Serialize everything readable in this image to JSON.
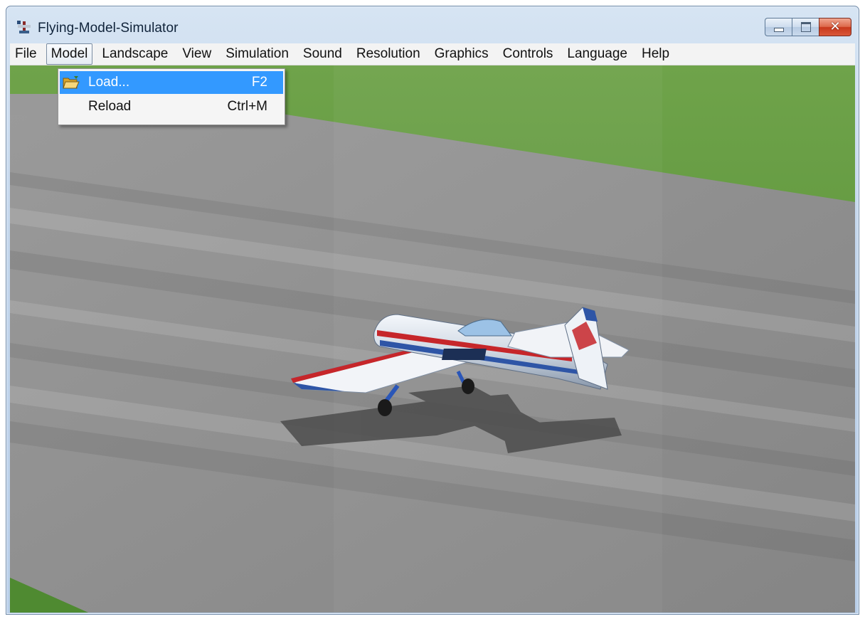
{
  "window": {
    "title": "Flying-Model-Simulator",
    "icon": "plane-app-icon",
    "caption_buttons": [
      "minimize-icon",
      "maximize-icon",
      "close-icon"
    ]
  },
  "menubar": {
    "items": [
      "File",
      "Model",
      "Landscape",
      "View",
      "Simulation",
      "Sound",
      "Resolution",
      "Graphics",
      "Controls",
      "Language",
      "Help"
    ],
    "open_item": "Model"
  },
  "model_menu": {
    "items": [
      {
        "label": "Load...",
        "shortcut": "F2",
        "icon": "open-folder-icon",
        "highlighted": true
      },
      {
        "label": "Reload",
        "shortcut": "Ctrl+M",
        "highlighted": false
      }
    ]
  },
  "colors": {
    "highlight": "#3399ff",
    "grass": "#5e9b3c",
    "runway": "#8f8f8f"
  }
}
